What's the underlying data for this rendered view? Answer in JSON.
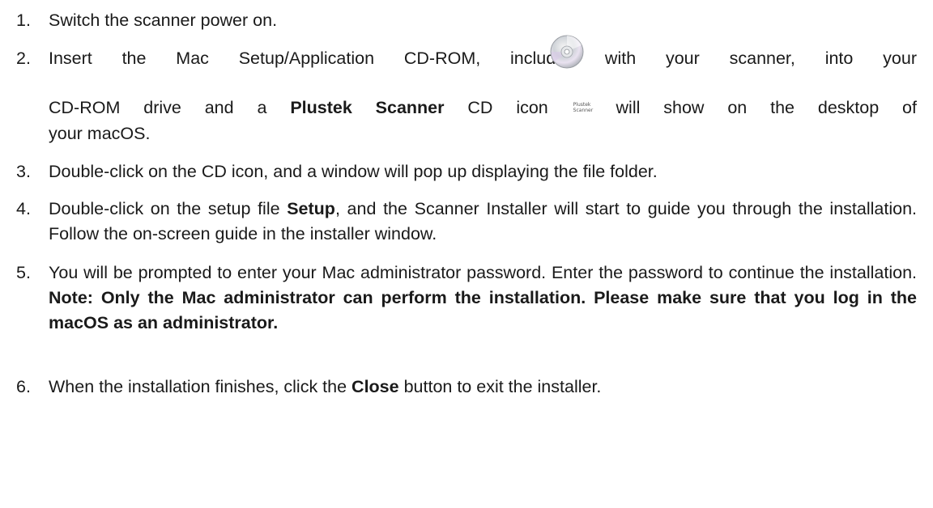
{
  "steps": [
    {
      "number": "1.",
      "text": "Switch the scanner power on."
    },
    {
      "number": "2.",
      "line1": "Insert the Mac Setup/Application CD-ROM, included with your scanner, into your",
      "line2_a": "CD-ROM drive and a ",
      "line2_bold": "Plustek Scanner",
      "line2_b": " CD icon",
      "line2_c": " will show on the desktop of",
      "line3": "your macOS.",
      "icon_label_top": "Plustek",
      "icon_label_bottom": "Scanner"
    },
    {
      "number": "3.",
      "text": "Double-click on the CD icon, and a window will pop up displaying the file folder."
    },
    {
      "number": "4.",
      "text_a": "Double-click on the setup file ",
      "text_bold": "Setup",
      "text_b": ", and the Scanner Installer will start to guide you through the installation. Follow the on-screen guide in the installer window."
    },
    {
      "number": "5.",
      "text_a": "You will be prompted to enter your Mac administrator password. Enter the password to continue the installation. ",
      "text_bold": "Note: Only the Mac administrator can perform the installation. Please make sure that you log in the macOS as an administrator."
    },
    {
      "number": "6.",
      "text_a": "When the installation finishes, click the ",
      "text_bold": "Close",
      "text_b": " button to exit the installer."
    }
  ],
  "icons": {
    "disc": "cd-disc-icon",
    "mini": "plustek-scanner-icon"
  }
}
